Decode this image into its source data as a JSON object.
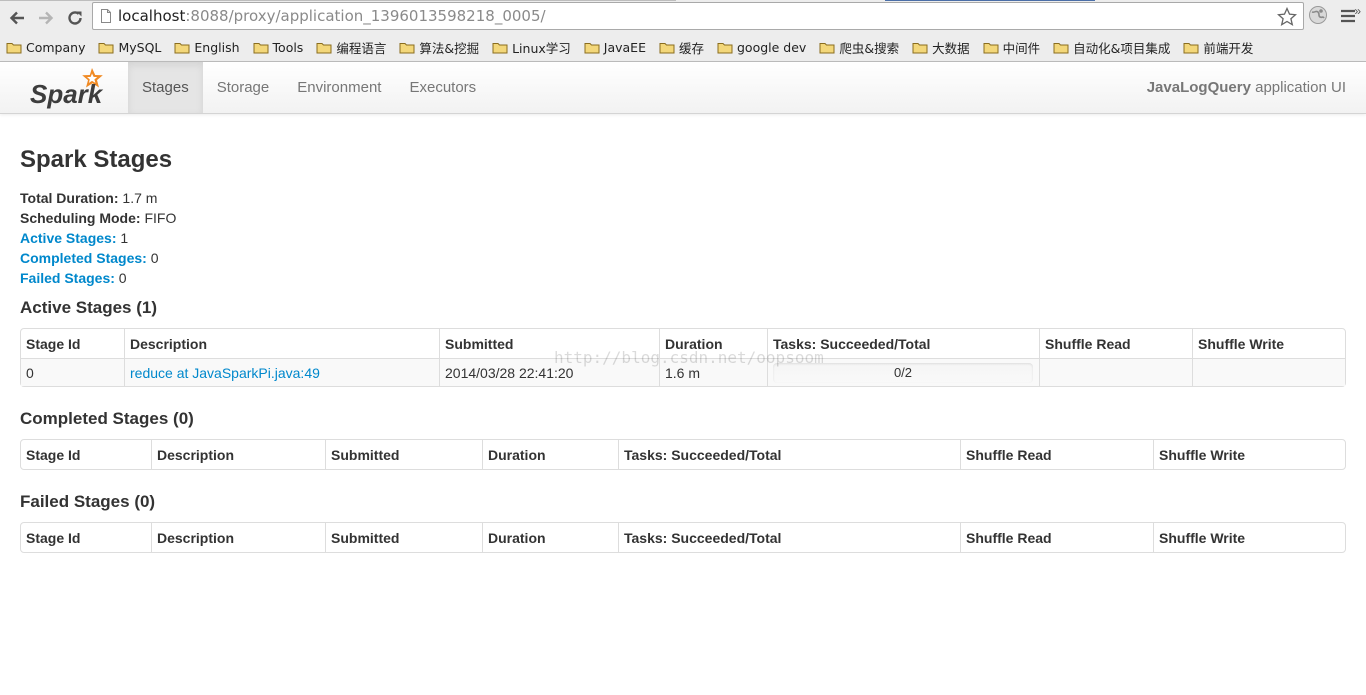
{
  "browser": {
    "url_host": "localhost",
    "url_rest": ":8088/proxy/application_1396013598218_0005/",
    "bookmarks": [
      "Company",
      "MySQL",
      "English",
      "Tools",
      "编程语言",
      "算法&挖掘",
      "Linux学习",
      "JavaEE",
      "缓存",
      "google dev",
      "爬虫&搜索",
      "大数据",
      "中间件",
      "自动化&项目集成",
      "前端开发"
    ],
    "bookmarks_more": "»"
  },
  "navbar": {
    "brand": "Spark",
    "tabs": [
      "Stages",
      "Storage",
      "Environment",
      "Executors"
    ],
    "active_tab": "Stages",
    "app_name": "JavaLogQuery",
    "app_suffix": " application UI"
  },
  "page": {
    "title": "Spark Stages",
    "summary": {
      "total_duration_label": "Total Duration:",
      "total_duration_value": " 1.7 m",
      "scheduling_mode_label": "Scheduling Mode:",
      "scheduling_mode_value": " FIFO",
      "active_stages_label": "Active Stages:",
      "active_stages_value": " 1",
      "completed_stages_label": "Completed Stages:",
      "completed_stages_value": " 0",
      "failed_stages_label": "Failed Stages:",
      "failed_stages_value": " 0"
    }
  },
  "columns": [
    "Stage Id",
    "Description",
    "Submitted",
    "Duration",
    "Tasks: Succeeded/Total",
    "Shuffle Read",
    "Shuffle Write"
  ],
  "active": {
    "heading": "Active Stages (1)",
    "rows": [
      {
        "stage_id": "0",
        "description": "reduce at JavaSparkPi.java:49",
        "submitted": "2014/03/28 22:41:20",
        "duration": "1.6 m",
        "tasks_text": "0/2",
        "tasks_succeeded": 0,
        "tasks_total": 2,
        "shuffle_read": "",
        "shuffle_write": ""
      }
    ]
  },
  "completed": {
    "heading": "Completed Stages (0)"
  },
  "failed": {
    "heading": "Failed Stages (0)"
  },
  "watermark": "http://blog.csdn.net/oopsoom",
  "colors": {
    "link": "#0088cc",
    "progress_bar": "#3EC0FF",
    "brand_orange": "#F08A24"
  }
}
